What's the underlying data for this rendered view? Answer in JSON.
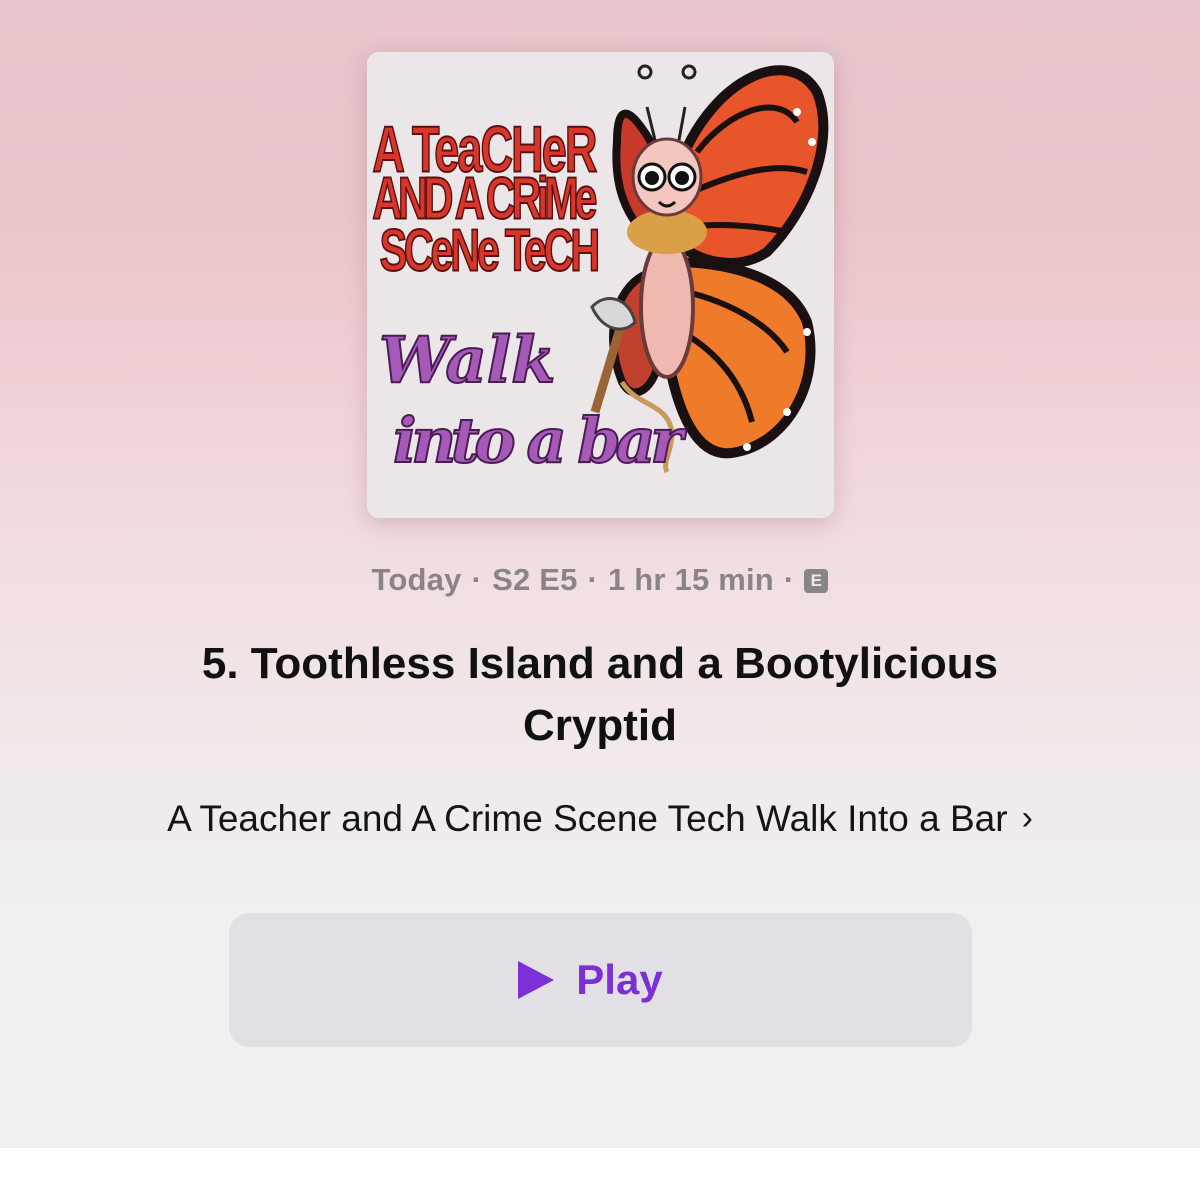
{
  "artwork": {
    "title_lines": [
      "A TeaCHeR",
      "AND A CRiMe",
      "SCeNe TeCH"
    ],
    "script_lines": [
      "Walk",
      "into a bar"
    ]
  },
  "episode": {
    "date": "Today",
    "season_episode": "S2 E5",
    "duration": "1 hr 15 min",
    "explicit_badge": "E",
    "separator": "·",
    "title": "5. Toothless Island and a Bootylicious Cryptid"
  },
  "show": {
    "name": "A Teacher and A Crime Scene Tech Walk Into a Bar",
    "chevron": "›"
  },
  "play_button": {
    "label": "Play",
    "accent_color": "#7b2fd6"
  },
  "colors": {
    "background_top": "#e7c6cb",
    "background_bottom": "#f0f0f0"
  }
}
